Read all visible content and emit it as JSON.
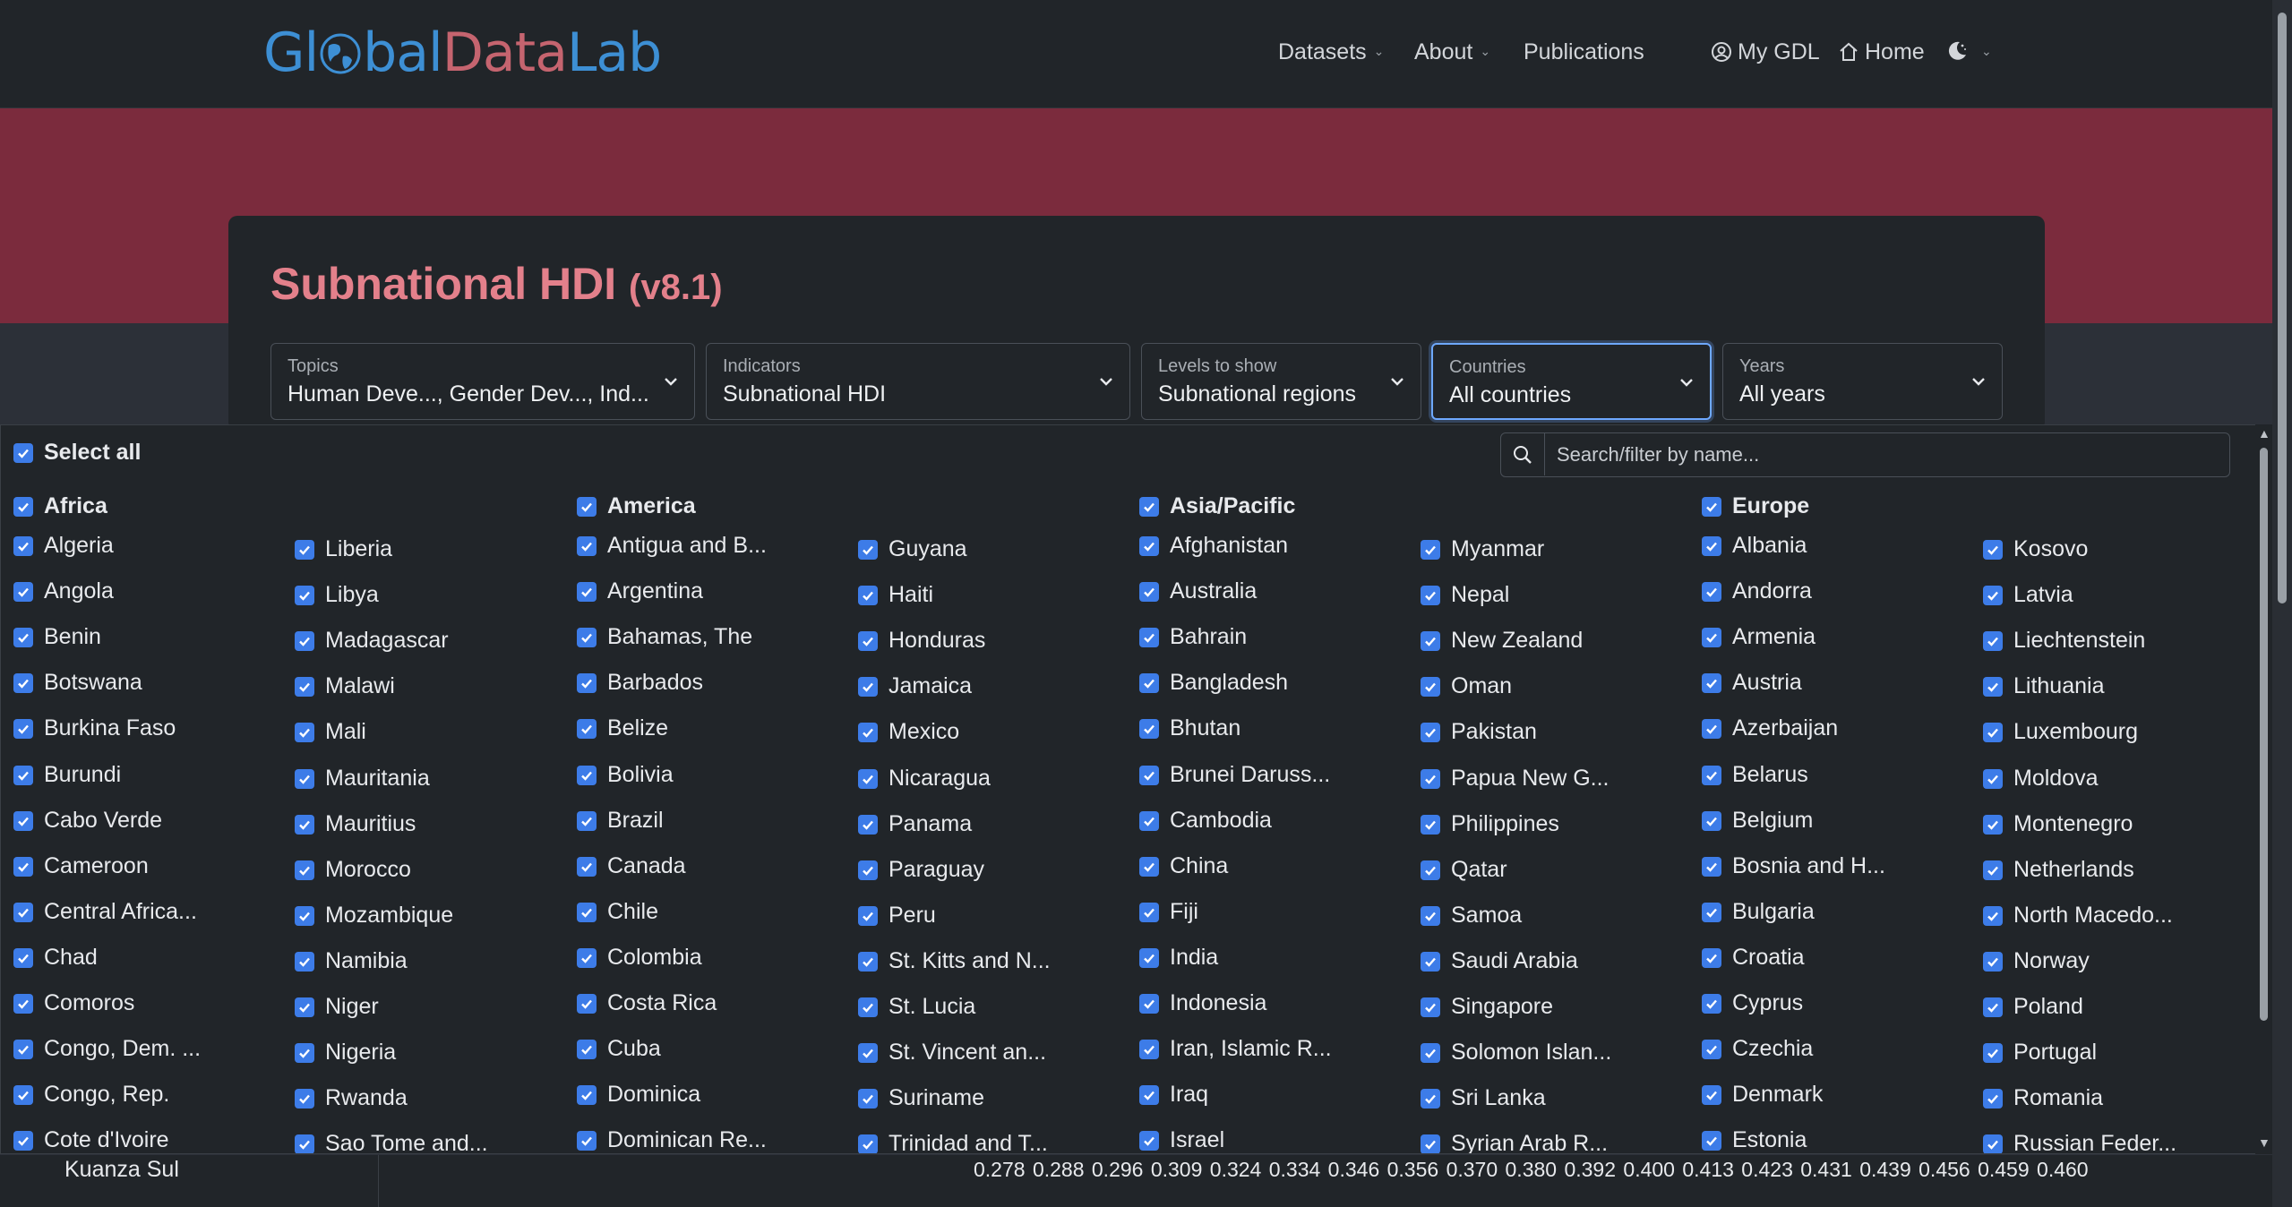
{
  "logo": {
    "part1": "Gl",
    "part2": "bal",
    "part3": "Data",
    "part4": "Lab"
  },
  "nav": {
    "datasets": "Datasets",
    "about": "About",
    "publications": "Publications",
    "my_gdl": "My GDL",
    "home": "Home"
  },
  "page": {
    "title": "Subnational HDI",
    "version": "(v8.1)"
  },
  "filters": [
    {
      "label": "Topics",
      "value": "Human Deve..., Gender Dev..., Ind..."
    },
    {
      "label": "Indicators",
      "value": "Subnational HDI"
    },
    {
      "label": "Levels to show",
      "value": "Subnational regions"
    },
    {
      "label": "Countries",
      "value": "All countries"
    },
    {
      "label": "Years",
      "value": "All years"
    }
  ],
  "dropdown": {
    "select_all": "Select all",
    "search_placeholder": "Search/filter by name...",
    "groups": [
      {
        "region": "Africa",
        "col1": [
          "Algeria",
          "Angola",
          "Benin",
          "Botswana",
          "Burkina Faso",
          "Burundi",
          "Cabo Verde",
          "Cameroon",
          "Central Africa...",
          "Chad",
          "Comoros",
          "Congo, Dem. ...",
          "Congo, Rep.",
          "Cote d'Ivoire"
        ],
        "col2": [
          "Liberia",
          "Libya",
          "Madagascar",
          "Malawi",
          "Mali",
          "Mauritania",
          "Mauritius",
          "Morocco",
          "Mozambique",
          "Namibia",
          "Niger",
          "Nigeria",
          "Rwanda",
          "Sao Tome and..."
        ]
      },
      {
        "region": "America",
        "col1": [
          "Antigua and B...",
          "Argentina",
          "Bahamas, The",
          "Barbados",
          "Belize",
          "Bolivia",
          "Brazil",
          "Canada",
          "Chile",
          "Colombia",
          "Costa Rica",
          "Cuba",
          "Dominica",
          "Dominican Re..."
        ],
        "col2": [
          "Guyana",
          "Haiti",
          "Honduras",
          "Jamaica",
          "Mexico",
          "Nicaragua",
          "Panama",
          "Paraguay",
          "Peru",
          "St. Kitts and N...",
          "St. Lucia",
          "St. Vincent an...",
          "Suriname",
          "Trinidad and T..."
        ]
      },
      {
        "region": "Asia/Pacific",
        "col1": [
          "Afghanistan",
          "Australia",
          "Bahrain",
          "Bangladesh",
          "Bhutan",
          "Brunei Daruss...",
          "Cambodia",
          "China",
          "Fiji",
          "India",
          "Indonesia",
          "Iran, Islamic R...",
          "Iraq",
          "Israel"
        ],
        "col2": [
          "Myanmar",
          "Nepal",
          "New Zealand",
          "Oman",
          "Pakistan",
          "Papua New G...",
          "Philippines",
          "Qatar",
          "Samoa",
          "Saudi Arabia",
          "Singapore",
          "Solomon Islan...",
          "Sri Lanka",
          "Syrian Arab R..."
        ]
      },
      {
        "region": "Europe",
        "col1": [
          "Albania",
          "Andorra",
          "Armenia",
          "Austria",
          "Azerbaijan",
          "Belarus",
          "Belgium",
          "Bosnia and H...",
          "Bulgaria",
          "Croatia",
          "Cyprus",
          "Czechia",
          "Denmark",
          "Estonia"
        ],
        "col2": [
          "Kosovo",
          "Latvia",
          "Liechtenstein",
          "Lithuania",
          "Luxembourg",
          "Moldova",
          "Montenegro",
          "Netherlands",
          "North Macedo...",
          "Norway",
          "Poland",
          "Portugal",
          "Romania",
          "Russian Feder..."
        ]
      }
    ]
  },
  "table_behind": {
    "region": "Kuanza Sul",
    "values": "0.278 0.288 0.296 0.309 0.324 0.334 0.346 0.356 0.370 0.380 0.392 0.400 0.413 0.423 0.431 0.439 0.456 0.459 0.460"
  },
  "colors": {
    "accent": "#3d7ce8",
    "brand_red": "#7b2b3d",
    "title": "#e3808b",
    "logo_blue": "#3d8fd4"
  }
}
